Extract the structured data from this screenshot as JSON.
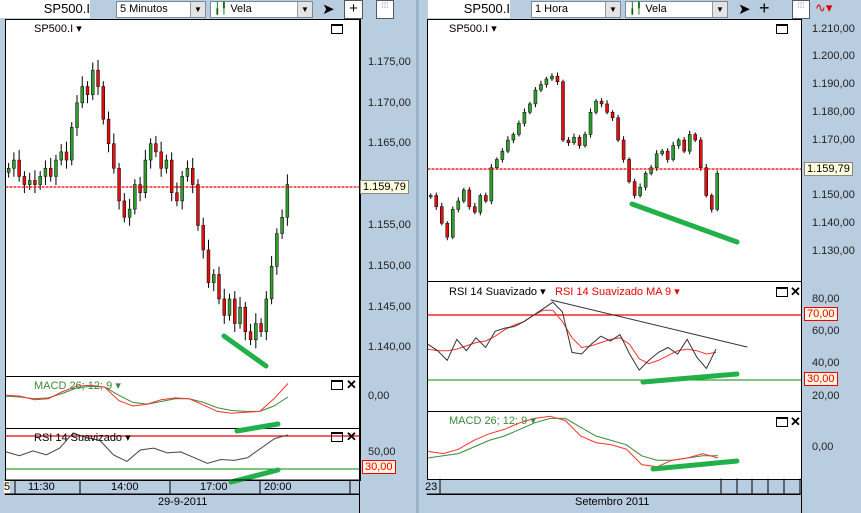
{
  "left": {
    "symbol": "SP500.I",
    "interval": "5 Minutos",
    "chart_type": "Vela",
    "chart_label": "SP500.I",
    "price_tag": "1.159,79",
    "y_ticks": [
      "1.175,00",
      "1.170,00",
      "1.165,00",
      "1.160,00",
      "1.155,00",
      "1.150,00",
      "1.145,00",
      "1.140,00"
    ],
    "macd_label": "MACD 26; 12; 9",
    "macd_tick": "0,00",
    "rsi_label": "RSI 14 Suavizado",
    "rsi_tick": "50,00",
    "rsi_tag": "30,00",
    "time_ticks": [
      "5",
      "11:30",
      "14:00",
      "17:00",
      "20:00"
    ],
    "date": "29-9-2011"
  },
  "right": {
    "symbol": "SP500.I",
    "interval": "1 Hora",
    "chart_type": "Vela",
    "chart_label": "SP500.I",
    "price_tag": "1.159,79",
    "y_ticks": [
      "1.210,00",
      "1.200,00",
      "1.190,00",
      "1.180,00",
      "1.170,00",
      "1.150,00",
      "1.140,00",
      "1.130,00"
    ],
    "rsi_label": "RSI 14 Suavizado",
    "rsi_ma_label": "RSI 14 Suavizado MA 9",
    "rsi_ticks": [
      "80,00",
      "60,00",
      "40,00",
      "20,00"
    ],
    "rsi_tag_high": "70,00",
    "rsi_tag_low": "30,00",
    "macd_label": "MACD 26; 12; 9",
    "macd_tick": "0,00",
    "time_ticks": [
      "23"
    ],
    "date": "Setembro 2011"
  },
  "colors": {
    "up": "#2e9e2e",
    "down": "#e01010",
    "divergence": "#22b04a",
    "macd_signal": "#3a8a3a",
    "rsi": "#333333",
    "ma": "#ff3030"
  },
  "chart_data": [
    {
      "type": "candlestick",
      "name": "SP500.I 5 Minutos",
      "ylim": [
        1136,
        1178
      ],
      "closes": [
        1162,
        1163,
        1161,
        1160,
        1160.5,
        1160,
        1161,
        1162,
        1161,
        1163,
        1164,
        1163,
        1167,
        1170,
        1172,
        1171,
        1174,
        1172,
        1168,
        1165,
        1162,
        1158,
        1156,
        1157,
        1160,
        1159,
        1163,
        1165,
        1164,
        1162,
        1163,
        1159,
        1158,
        1161,
        1162,
        1160,
        1155,
        1152,
        1148,
        1149,
        1146,
        1144,
        1146,
        1143,
        1145,
        1142,
        1141,
        1143,
        1142,
        1146,
        1150,
        1154,
        1156,
        1160
      ]
    },
    {
      "type": "line",
      "name": "MACD 26; 12; 9 (5 min)",
      "macd": [
        0.2,
        0.1,
        -0.3,
        -0.2,
        0.6,
        1.2,
        1.3,
        1.1,
        -0.4,
        -1.0,
        -0.8,
        -0.3,
        -0.1,
        -0.2,
        -0.9,
        -1.6,
        -1.8,
        -1.7,
        -1.6,
        -0.2,
        1.5
      ],
      "signal": [
        0.1,
        0.0,
        -0.2,
        -0.1,
        0.4,
        1.0,
        1.2,
        1.1,
        0.2,
        -0.6,
        -0.8,
        -0.5,
        -0.2,
        -0.2,
        -0.6,
        -1.2,
        -1.5,
        -1.6,
        -1.6,
        -1.0,
        0.0
      ]
    },
    {
      "type": "line",
      "name": "RSI 14 Suavizado (5 min)",
      "rsi": [
        48,
        44,
        49,
        45,
        52,
        68,
        63,
        60,
        45,
        38,
        50,
        52,
        47,
        48,
        42,
        36,
        40,
        39,
        42,
        52,
        62,
        66
      ]
    },
    {
      "type": "candlestick",
      "name": "SP500.I 1 Hora",
      "ylim": [
        1125,
        1212
      ],
      "closes": [
        1150,
        1146,
        1140,
        1135,
        1145,
        1148,
        1152,
        1146,
        1144,
        1150,
        1148,
        1160,
        1163,
        1166,
        1170,
        1172,
        1176,
        1180,
        1183,
        1188,
        1190,
        1192,
        1193,
        1191,
        1170,
        1169,
        1171,
        1168,
        1172,
        1180,
        1184,
        1183,
        1180,
        1178,
        1170,
        1163,
        1155,
        1150,
        1153,
        1158,
        1160,
        1165,
        1166,
        1163,
        1168,
        1170,
        1166,
        1172,
        1170,
        1160,
        1150,
        1145,
        1158
      ]
    },
    {
      "type": "line",
      "name": "RSI 14 Suavizado / MA 9 (1 Hora)",
      "ylim": [
        15,
        85
      ],
      "rsi": [
        52,
        48,
        42,
        55,
        48,
        56,
        50,
        60,
        62,
        63,
        66,
        70,
        74,
        78,
        72,
        47,
        46,
        52,
        57,
        54,
        58,
        46,
        36,
        42,
        47,
        50,
        46,
        55,
        44,
        37,
        49
      ],
      "ma": [
        49,
        48,
        48,
        49,
        51,
        53,
        54,
        57,
        61,
        64,
        66,
        70,
        73,
        73,
        66,
        56,
        50,
        51,
        53,
        55,
        56,
        52,
        43,
        40,
        42,
        45,
        48,
        49,
        48,
        46,
        47
      ],
      "trendline": [
        78,
        51
      ],
      "levels": [
        70,
        30
      ]
    },
    {
      "type": "line",
      "name": "MACD 26; 12; 9 (1 Hora)",
      "macd": [
        -0.2,
        -0.3,
        -0.1,
        0.3,
        0.6,
        0.8,
        1.1,
        1.3,
        1.4,
        1.2,
        0.5,
        0.2,
        0.1,
        -0.1,
        -0.8,
        -0.9,
        -0.6,
        -0.5,
        -0.3,
        -0.5
      ],
      "signal": [
        -0.5,
        -0.4,
        -0.3,
        0.0,
        0.3,
        0.5,
        0.8,
        1.1,
        1.3,
        1.3,
        0.9,
        0.5,
        0.3,
        0.1,
        -0.4,
        -0.6,
        -0.6,
        -0.5,
        -0.4,
        -0.4
      ]
    }
  ]
}
